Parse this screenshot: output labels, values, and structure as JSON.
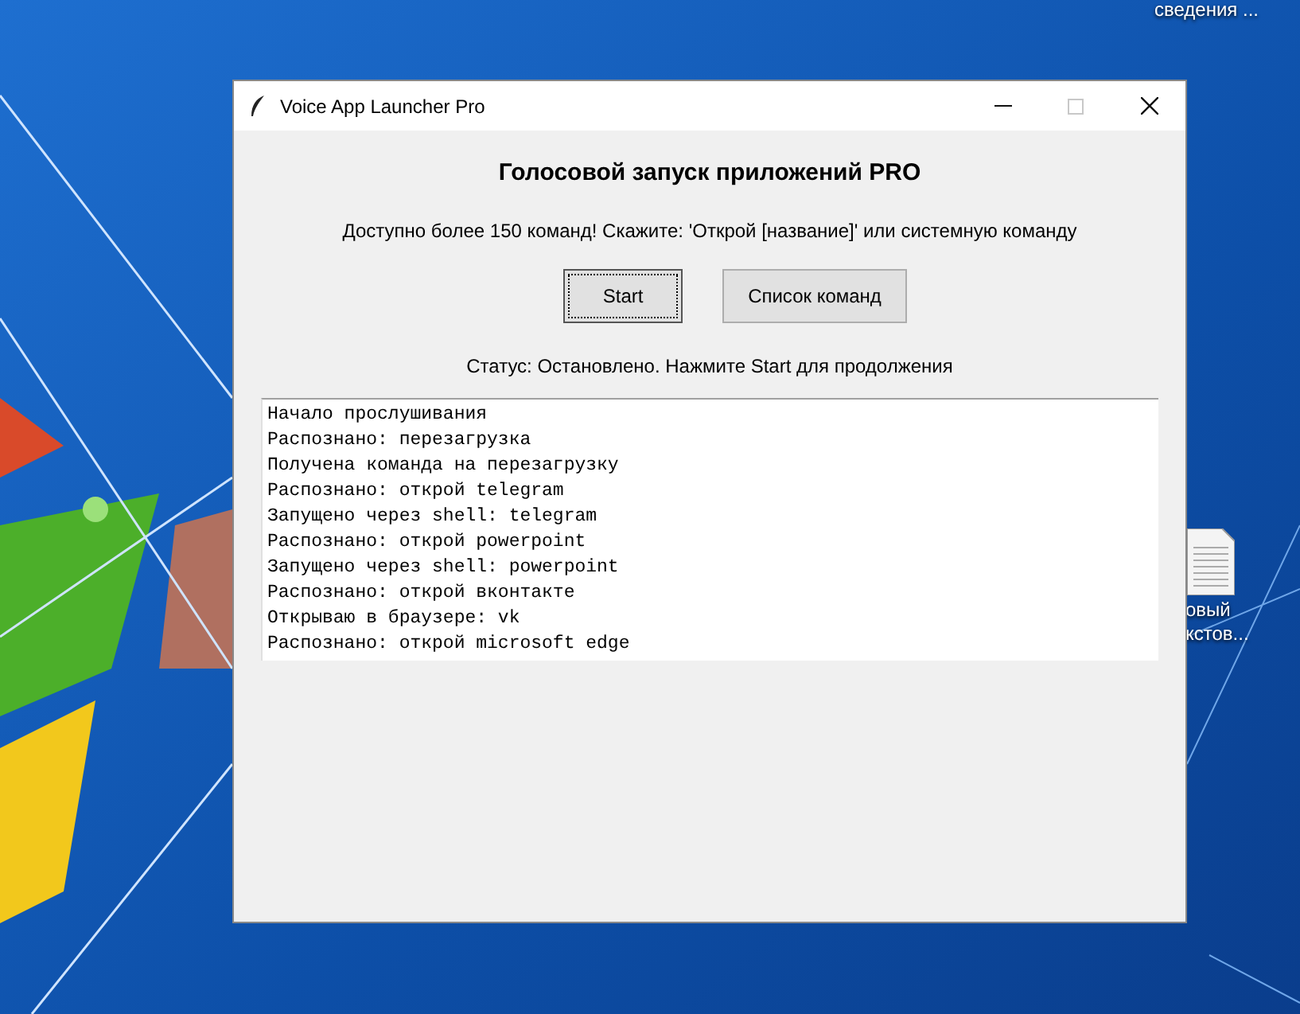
{
  "desktop": {
    "icons": [
      {
        "kind": "none",
        "label": "сведения ..."
      },
      {
        "kind": "document",
        "label": "овый\nкстов..."
      }
    ]
  },
  "window": {
    "title": "Voice App Launcher Pro",
    "controls": [
      {
        "kind": "minimize"
      },
      {
        "kind": "maximize",
        "disabled": true
      },
      {
        "kind": "close"
      }
    ]
  },
  "heading": "Голосовой запуск приложений PRO",
  "subtitle": "Доступно более 150 команд! Скажите: 'Открой [название]' или системную команду",
  "buttons": [
    {
      "label": "Start",
      "focused": true
    },
    {
      "label": "Список команд",
      "focused": false
    }
  ],
  "status": "Статус: Остановлено. Нажмите Start для продолжения",
  "log": [
    "Начало прослушивания",
    "Распознано: перезагрузка",
    "Получена команда на перезагрузку",
    "Распознано: открой telegram",
    "Запущено через shell: telegram",
    "Распознано: открой powerpoint",
    "Запущено через shell: powerpoint",
    "Распознано: открой вконтакте",
    "Открываю в браузере: vk",
    "Распознано: открой microsoft edge"
  ]
}
